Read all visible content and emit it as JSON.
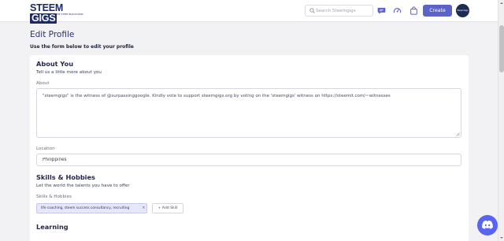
{
  "header": {
    "logo_text_a": "STEEM",
    "logo_text_b": "GIGS",
    "logo_tagline": "POWERED BY THE STEEM BLOCKCHAIN",
    "search_placeholder": "Search Steemgigs",
    "create_label": "Create",
    "avatar_text": "SteemGigs",
    "icons": [
      "chat-icon",
      "dashboard-icon",
      "shopping-bag-icon"
    ]
  },
  "page": {
    "title": "Edit Profile",
    "subtitle": "Use the form below to edit your profile"
  },
  "about": {
    "title": "About You",
    "description": "Tell us a little more about you",
    "about_label": "About",
    "about_value": "\"steemgigs\" is the witness of @surpassinggoogle. Kindly vote to support steemgigs.org by voting on the 'steemgigs' witness on https://steemit.com/~witnesses",
    "location_label": "Location",
    "location_value": "Philippines"
  },
  "skills": {
    "title": "Skills & Hobbies",
    "description": "Let the world the talents you have to offer",
    "field_label": "Skills & Hobbies",
    "chip_text": "life coaching, steem success consultancy, recruiting",
    "chip_remove": "×",
    "add_label": "+ Add Skill"
  },
  "learning": {
    "title": "Learning"
  },
  "colors": {
    "accent": "#5b63c8",
    "title": "#2a2f78",
    "discord": "#5865f2",
    "avatar_bg": "#1d2b57"
  }
}
